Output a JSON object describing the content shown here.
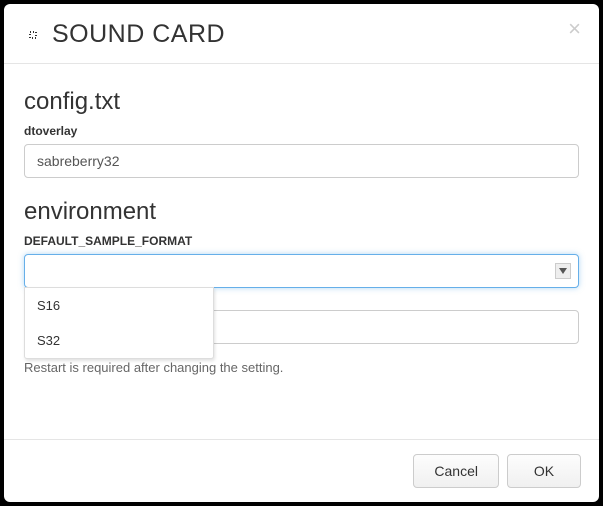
{
  "modal": {
    "title": "SOUND CARD",
    "close_symbol": "×"
  },
  "sections": {
    "config": {
      "heading": "config.txt",
      "dtoverlay_label": "dtoverlay",
      "dtoverlay_value": "sabreberry32"
    },
    "environment": {
      "heading": "environment",
      "default_sample_format_label": "DEFAULT_SAMPLE_FORMAT",
      "default_sample_format_value": "",
      "dropdown_options": [
        "S16",
        "S32"
      ],
      "other_value": "",
      "restart_note": "Restart is required after changing the setting."
    }
  },
  "footer": {
    "cancel_label": "Cancel",
    "ok_label": "OK"
  }
}
